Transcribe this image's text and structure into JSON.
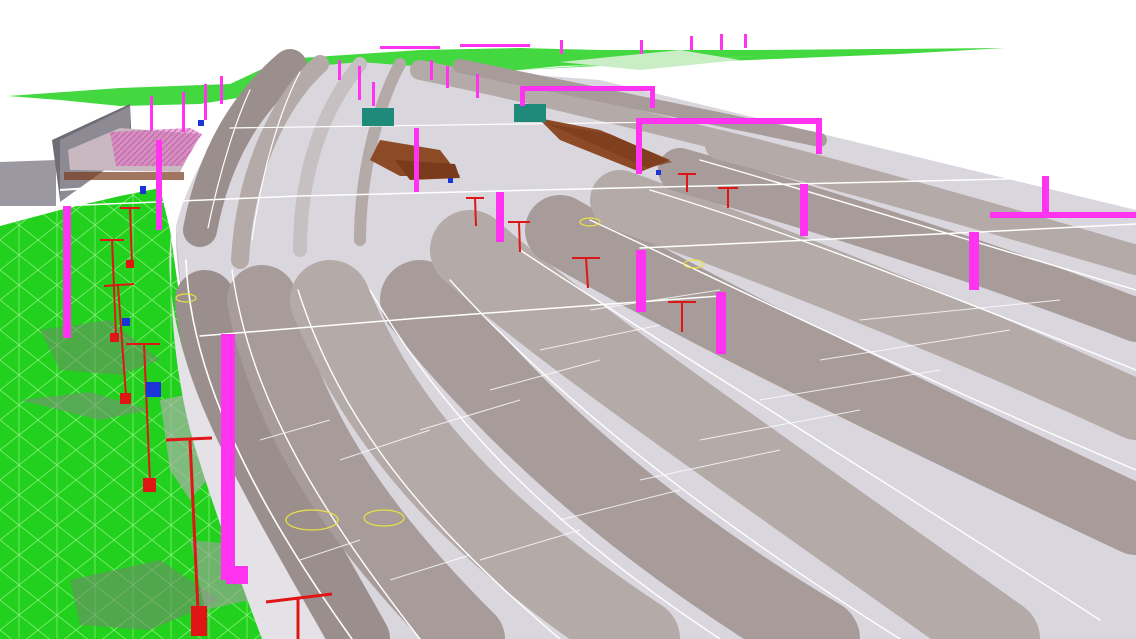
{
  "scene": {
    "description_label": "",
    "colors": {
      "sky": "#ffffff",
      "terrain": "#22d11e",
      "terrain_mesh": "#9af58f",
      "terrain_shadow": "#6f8a6a",
      "deck_light": "#d9d6dd",
      "deck_mid": "#c6c0c2",
      "deck_dark": "#9a8f8c",
      "track_band": "#b4aaa7",
      "edge_line": "#ffffff",
      "catenary_pole": "#ff33f0",
      "signal": "#e01616",
      "platform_roof": "#7a3a1c",
      "equipment_box": "#1f8a7a",
      "marker_blue": "#1a34d8",
      "building_wall": "#8d8a93",
      "building_roof": "#d96fc0",
      "annotation_yellow": "#e9e243"
    },
    "objects": {
      "viaduct": "elevated-rail-viaduct",
      "tracks": "multi-track-railway",
      "catenary": "overhead-catenary-masts",
      "signals": "trackside-signal-posts",
      "terrain": "green-terrain-mesh",
      "station": "station-platform-canopies",
      "building": "trackside-building"
    }
  }
}
